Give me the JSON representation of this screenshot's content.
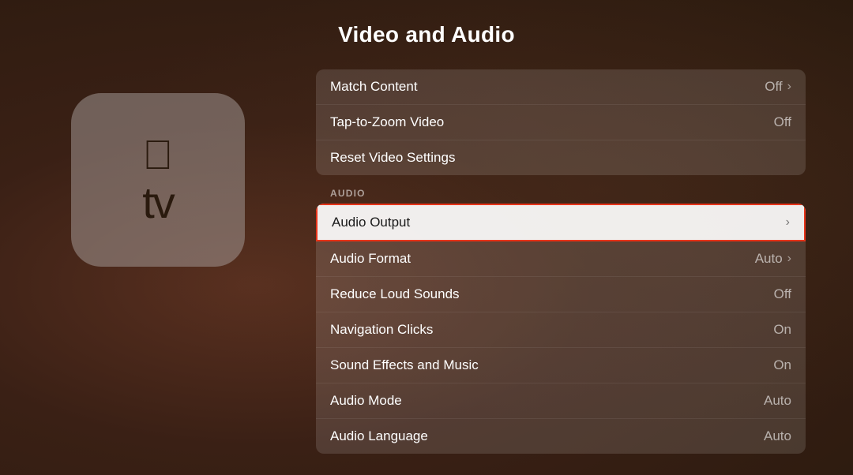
{
  "page": {
    "title": "Video and Audio"
  },
  "video_section": {
    "rows": [
      {
        "label": "Match Content",
        "value": "Off",
        "hasChevron": true
      },
      {
        "label": "Tap-to-Zoom Video",
        "value": "Off",
        "hasChevron": false
      },
      {
        "label": "Reset Video Settings",
        "value": "",
        "hasChevron": false
      }
    ]
  },
  "audio_section": {
    "label": "AUDIO",
    "rows": [
      {
        "label": "Audio Output",
        "value": "",
        "hasChevron": true,
        "highlighted": true
      },
      {
        "label": "Audio Format",
        "value": "Auto",
        "hasChevron": true
      },
      {
        "label": "Reduce Loud Sounds",
        "value": "Off",
        "hasChevron": false
      },
      {
        "label": "Navigation Clicks",
        "value": "On",
        "hasChevron": false
      },
      {
        "label": "Sound Effects and Music",
        "value": "On",
        "hasChevron": false
      },
      {
        "label": "Audio Mode",
        "value": "Auto",
        "hasChevron": false
      },
      {
        "label": "Audio Language",
        "value": "Auto",
        "hasChevron": false
      }
    ]
  },
  "device": {
    "tv_text": "tv"
  }
}
